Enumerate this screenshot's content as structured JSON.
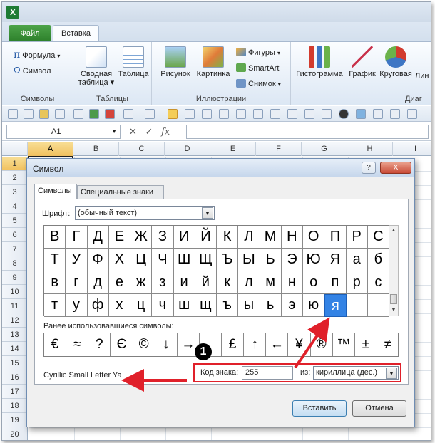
{
  "app": {
    "icon": "X"
  },
  "tabs": {
    "file": "Файл",
    "insert": "Вставка"
  },
  "ribbon": {
    "symbols_group": {
      "formula": "Формула",
      "symbol": "Символ",
      "label": "Символы"
    },
    "tables_group": {
      "pivot": "Сводная таблица",
      "pivot_line1": "Сводная",
      "pivot_line2": "таблица ▾",
      "table": "Таблица",
      "label": "Таблицы"
    },
    "illustrations_group": {
      "picture": "Рисунок",
      "clipart": "Картинка",
      "shapes": "Фигуры",
      "smartart": "SmartArt",
      "screenshot": "Снимок",
      "label": "Иллюстрации"
    },
    "charts_group": {
      "histogram": "Гистограмма",
      "graph": "График",
      "pie": "Круговая",
      "line_partial": "Лин",
      "label_partial": "Диаг"
    }
  },
  "formula_bar": {
    "name_box": "A1",
    "fx": "fx"
  },
  "sheet": {
    "columns": [
      "A",
      "B",
      "C",
      "D",
      "E",
      "F",
      "G",
      "H",
      "I"
    ],
    "rows": [
      "1",
      "2",
      "3",
      "4",
      "5",
      "6",
      "7",
      "8",
      "9",
      "10",
      "11",
      "12",
      "13",
      "14",
      "15",
      "16",
      "17",
      "18",
      "19",
      "20"
    ]
  },
  "dialog": {
    "title": "Символ",
    "help": "?",
    "close": "X",
    "tabs": [
      "Символы",
      "Специальные знаки"
    ],
    "font_label": "Шрифт:",
    "font_value": "(обычный текст)",
    "symbols": [
      [
        "В",
        "Г",
        "Д",
        "Е",
        "Ж",
        "З",
        "И",
        "Й",
        "К",
        "Л",
        "М",
        "Н",
        "О",
        "П",
        "Р",
        "С"
      ],
      [
        "Т",
        "У",
        "Ф",
        "Х",
        "Ц",
        "Ч",
        "Ш",
        "Щ",
        "Ъ",
        "Ы",
        "Ь",
        "Э",
        "Ю",
        "Я",
        "а",
        "б"
      ],
      [
        "в",
        "г",
        "д",
        "е",
        "ж",
        "з",
        "и",
        "й",
        "к",
        "л",
        "м",
        "н",
        "о",
        "п",
        "р",
        "с"
      ],
      [
        "т",
        "у",
        "ф",
        "х",
        "ц",
        "ч",
        "ш",
        "щ",
        "ъ",
        "ы",
        "ь",
        "э",
        "ю",
        "я",
        "",
        ""
      ]
    ],
    "selected_symbol": "я",
    "recent_label": "Ранее использовавшиеся символы:",
    "recent": [
      "€",
      "≈",
      "?",
      "Є",
      "©",
      "↓",
      "→",
      "",
      "£",
      "↑",
      "←",
      "¥",
      "®",
      "™",
      "±",
      "≠"
    ],
    "char_name": "Cyrillic Small Letter Ya",
    "code_label": "Код знака:",
    "code_value": "255",
    "from_label": "из:",
    "from_value": "кириллица (дес.)",
    "insert_button": "Вставить",
    "cancel_button": "Отмена"
  },
  "annotation": {
    "badge": "1",
    "color": "#e0202a"
  }
}
